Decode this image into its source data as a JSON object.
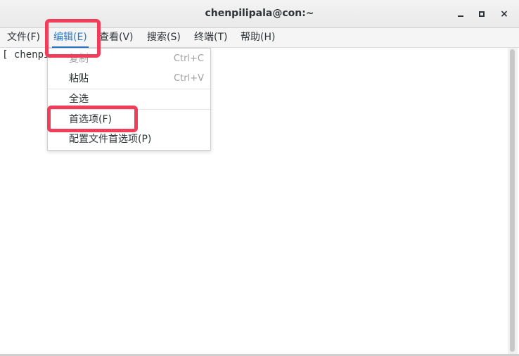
{
  "window": {
    "title": "chenpilipala@con:~",
    "buttons": {
      "minimize": "minimize",
      "maximize": "maximize",
      "close": "×"
    }
  },
  "menubar": {
    "items": [
      {
        "label": "文件(F)",
        "active": false
      },
      {
        "label": "编辑(E)",
        "active": true
      },
      {
        "label": "查看(V)",
        "active": false
      },
      {
        "label": "搜索(S)",
        "active": false
      },
      {
        "label": "终端(T)",
        "active": false
      },
      {
        "label": "帮助(H)",
        "active": false
      }
    ]
  },
  "terminal": {
    "prompt_text": "[ chenpi"
  },
  "edit_menu": {
    "items": [
      {
        "label": "复制",
        "shortcut": "Ctrl+C",
        "disabled": true
      },
      {
        "label": "粘贴",
        "shortcut": "Ctrl+V",
        "disabled": false
      },
      {
        "label": "全选",
        "shortcut": "",
        "disabled": false
      },
      {
        "label": "首选项(F)",
        "shortcut": "",
        "disabled": false
      },
      {
        "label": "配置文件首选项(P)",
        "shortcut": "",
        "disabled": false
      }
    ]
  },
  "colors": {
    "accent": "#2a76c6",
    "highlight": "#f03e5a",
    "text": "#2e3436",
    "disabled": "#a0a0a0"
  }
}
